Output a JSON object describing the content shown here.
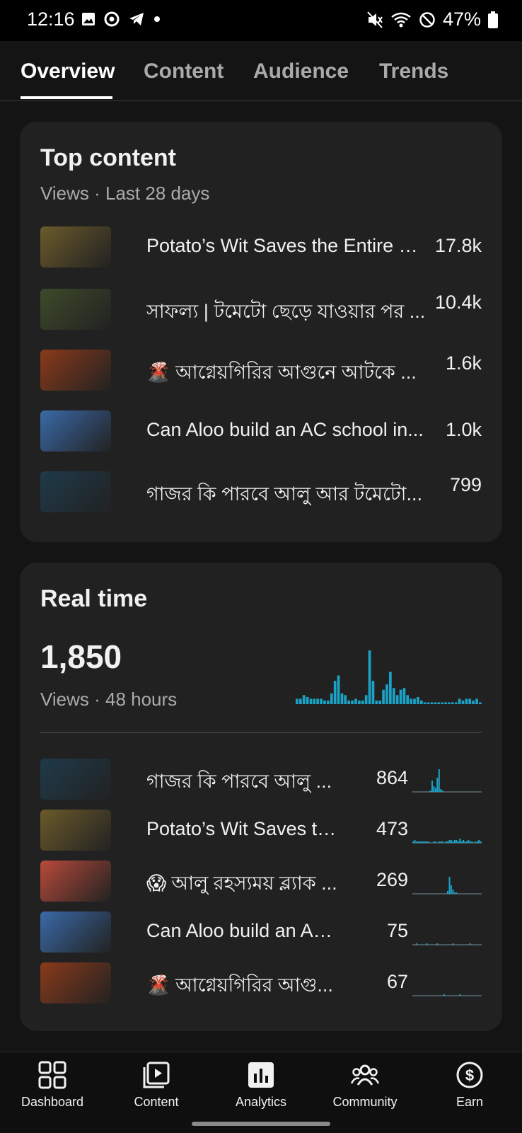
{
  "status_bar": {
    "time": "12:16",
    "battery": "47%"
  },
  "tabs": [
    {
      "label": "Overview",
      "active": true
    },
    {
      "label": "Content",
      "active": false
    },
    {
      "label": "Audience",
      "active": false
    },
    {
      "label": "Trends",
      "active": false
    }
  ],
  "top_content": {
    "title": "Top content",
    "subtitle": "Views · Last 28 days",
    "items": [
      {
        "title": "Potato’s Wit Saves the Entire Vi...",
        "views": "17.8k",
        "thumb_color": "#6b5a2a"
      },
      {
        "title": "সাফল্য | টমেটো ছেড়ে যাওয়ার পর ...",
        "views": "10.4k",
        "thumb_color": "#3d4a2a"
      },
      {
        "title": "🌋 আগ্নেয়গিরির আগুনে আটকে ...",
        "views": "1.6k",
        "thumb_color": "#8a3a1a"
      },
      {
        "title": "Can Aloo build an AC school in...",
        "views": "1.0k",
        "thumb_color": "#3a6aa8"
      },
      {
        "title": "গাজর কি পারবে আলু আর টমেটো...",
        "views": "799",
        "thumb_color": "#1e3a4a"
      }
    ]
  },
  "real_time": {
    "title": "Real time",
    "total": "1,850",
    "subtitle": "Views · 48 hours",
    "chart_bars": [
      3,
      3,
      5,
      4,
      3,
      3,
      3,
      3,
      2,
      2,
      6,
      13,
      16,
      6,
      5,
      2,
      2,
      3,
      2,
      2,
      5,
      30,
      13,
      2,
      2,
      8,
      11,
      18,
      9,
      5,
      8,
      9,
      5,
      3,
      3,
      4,
      2,
      1,
      1,
      1,
      1,
      1,
      1,
      1,
      1,
      1,
      1,
      3,
      2,
      3,
      3,
      2,
      3,
      1
    ],
    "items": [
      {
        "title": "গাজর কি পারবে আলু ...",
        "views": "864",
        "thumb_color": "#1e3a4a",
        "spark": [
          0,
          0,
          0,
          0,
          0,
          0,
          0,
          0,
          0,
          0,
          1,
          8,
          4,
          3,
          10,
          16,
          2,
          1,
          0,
          0,
          0,
          0,
          0,
          0,
          0,
          0,
          0,
          0,
          0,
          0,
          0,
          0,
          0,
          0,
          0,
          0,
          0,
          0,
          0,
          0
        ]
      },
      {
        "title": "Potato’s Wit Saves th...",
        "views": "473",
        "thumb_color": "#6b5a2a",
        "spark": [
          1,
          2,
          1,
          1,
          1,
          1,
          1,
          1,
          1,
          1,
          0,
          0,
          1,
          1,
          0,
          1,
          1,
          1,
          0,
          1,
          1,
          2,
          2,
          1,
          2,
          2,
          1,
          3,
          1,
          2,
          1,
          1,
          2,
          1,
          1,
          0,
          1,
          1,
          2,
          1
        ]
      },
      {
        "title": "😱 আলু রহস্যময় ব্ল্যাক ...",
        "views": "269",
        "thumb_color": "#b84a3a",
        "spark": [
          0,
          0,
          0,
          0,
          0,
          0,
          0,
          0,
          0,
          0,
          0,
          0,
          0,
          0,
          0,
          0,
          0,
          0,
          0,
          0,
          2,
          12,
          6,
          3,
          1,
          1,
          0,
          0,
          0,
          0,
          0,
          0,
          0,
          0,
          0,
          0,
          0,
          0,
          0,
          0
        ]
      },
      {
        "title": "Can Aloo build an AC...",
        "views": "75",
        "thumb_color": "#3a6aa8",
        "spark": [
          0,
          0,
          1,
          0,
          0,
          0,
          0,
          0,
          1,
          0,
          0,
          0,
          0,
          0,
          1,
          0,
          0,
          0,
          0,
          0,
          0,
          0,
          0,
          1,
          0,
          0,
          0,
          0,
          0,
          0,
          0,
          0,
          0,
          1,
          0,
          0,
          0,
          0,
          0,
          0
        ]
      },
      {
        "title": "🌋 আগ্নেয়গিরির আগু...",
        "views": "67",
        "thumb_color": "#8a3a1a",
        "spark": [
          0,
          0,
          0,
          0,
          0,
          0,
          0,
          0,
          0,
          0,
          0,
          0,
          0,
          0,
          0,
          0,
          0,
          0,
          1,
          0,
          0,
          0,
          0,
          0,
          0,
          0,
          0,
          1,
          0,
          0,
          0,
          0,
          0,
          0,
          0,
          0,
          0,
          0,
          0,
          0
        ]
      }
    ]
  },
  "bottom_nav": [
    {
      "label": "Dashboard",
      "icon": "dashboard-icon"
    },
    {
      "label": "Content",
      "icon": "content-icon"
    },
    {
      "label": "Analytics",
      "icon": "analytics-icon"
    },
    {
      "label": "Community",
      "icon": "community-icon"
    },
    {
      "label": "Earn",
      "icon": "earn-icon"
    }
  ],
  "colors": {
    "accent_bar": "#1aa3c7",
    "card_bg": "#212121",
    "page_bg": "#141414"
  }
}
